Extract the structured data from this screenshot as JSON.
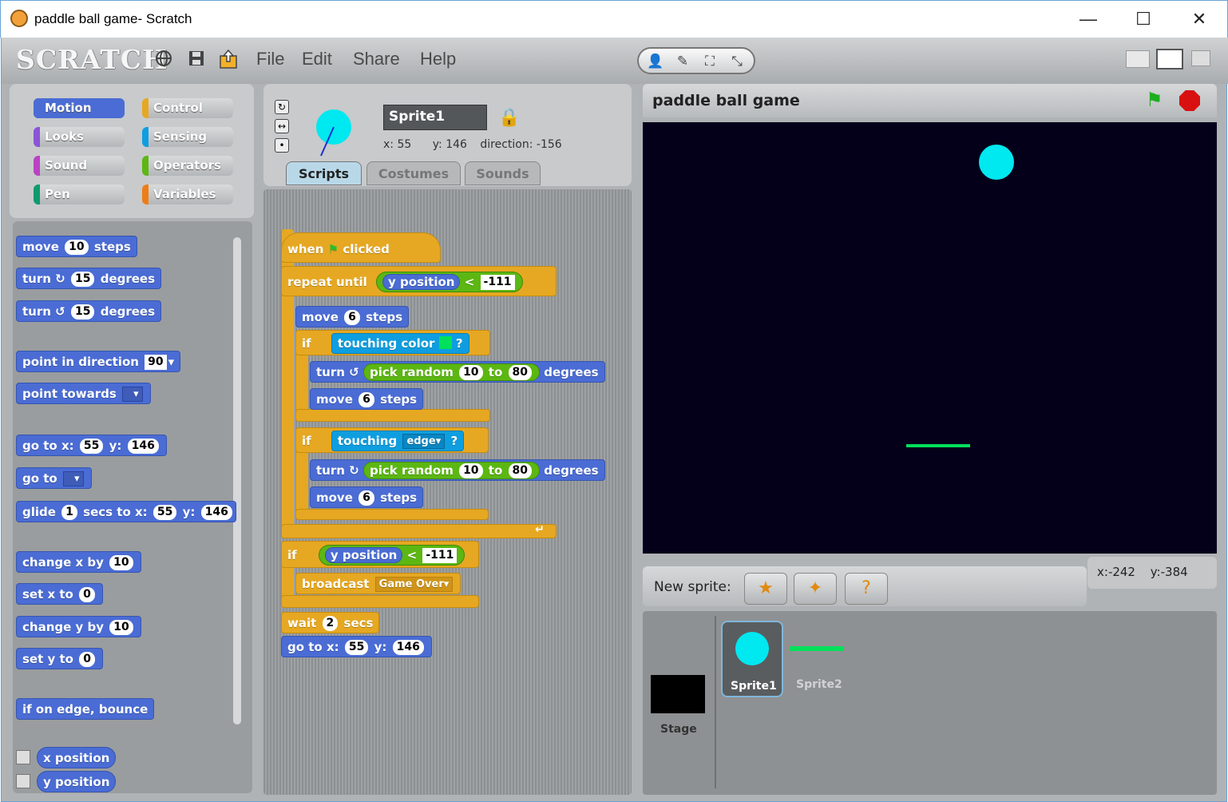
{
  "window": {
    "title": "paddle ball game- Scratch",
    "minimize": "—",
    "maximize": "☐",
    "close": "✕"
  },
  "menubar": {
    "logo": "SCRATCH",
    "items": [
      "File",
      "Edit",
      "Share",
      "Help"
    ],
    "icons": [
      "globe-icon",
      "save-icon",
      "share-icon"
    ],
    "tools": [
      "👤",
      "✎",
      "⛶",
      "⤡"
    ]
  },
  "categories": [
    {
      "label": "Motion",
      "color": "#4a6cd4"
    },
    {
      "label": "Control",
      "color": "#e6a822"
    },
    {
      "label": "Looks",
      "color": "#8a55d7"
    },
    {
      "label": "Sensing",
      "color": "#0e9ee0"
    },
    {
      "label": "Sound",
      "color": "#bb42c3"
    },
    {
      "label": "Operators",
      "color": "#5cb712"
    },
    {
      "label": "Pen",
      "color": "#0e9a6c"
    },
    {
      "label": "Variables",
      "color": "#ee7d16"
    }
  ],
  "palette": {
    "move": {
      "a": "move",
      "n": "10",
      "b": "steps"
    },
    "turn_cw": {
      "a": "turn",
      "n": "15",
      "b": "degrees"
    },
    "turn_ccw": {
      "a": "turn",
      "n": "15",
      "b": "degrees"
    },
    "point_dir": {
      "a": "point in direction",
      "n": "90"
    },
    "point_towards": {
      "a": "point towards"
    },
    "goto_xy": {
      "a": "go to x:",
      "x": "55",
      "b": "y:",
      "y": "146"
    },
    "goto": {
      "a": "go to"
    },
    "glide": {
      "a": "glide",
      "n": "1",
      "b": "secs to x:",
      "x": "55",
      "c": "y:",
      "y": "146"
    },
    "change_x": {
      "a": "change x by",
      "n": "10"
    },
    "set_x": {
      "a": "set x to",
      "n": "0"
    },
    "change_y": {
      "a": "change y by",
      "n": "10"
    },
    "set_y": {
      "a": "set y to",
      "n": "0"
    },
    "bounce": {
      "a": "if on edge, bounce"
    },
    "xpos": {
      "a": "x position"
    },
    "ypos": {
      "a": "y position"
    }
  },
  "sprite": {
    "name": "Sprite1",
    "x_label": "x:",
    "x": "55",
    "y_label": "y:",
    "y": "146",
    "dir_label": "direction:",
    "direction": "-156"
  },
  "tabs": [
    "Scripts",
    "Costumes",
    "Sounds"
  ],
  "script": {
    "hat": {
      "a": "when",
      "b": "clicked"
    },
    "repeat": {
      "a": "repeat until",
      "rep": "y position",
      "op": "<",
      "val": "-111"
    },
    "move1": {
      "a": "move",
      "n": "6",
      "b": "steps"
    },
    "if1": {
      "a": "if",
      "c": "touching color",
      "q": "?"
    },
    "turn1": {
      "a": "turn",
      "r": "pick random",
      "n1": "10",
      "to": "to",
      "n2": "80",
      "b": "degrees"
    },
    "move2": {
      "a": "move",
      "n": "6",
      "b": "steps"
    },
    "if2": {
      "a": "if",
      "c": "touching",
      "opt": "edge",
      "q": "?"
    },
    "turn2": {
      "a": "turn",
      "r": "pick random",
      "n1": "10",
      "to": "to",
      "n2": "80",
      "b": "degrees"
    },
    "move3": {
      "a": "move",
      "n": "6",
      "b": "steps"
    },
    "if3": {
      "a": "if",
      "rep": "y position",
      "op": "<",
      "val": "-111"
    },
    "broadcast": {
      "a": "broadcast",
      "opt": "Game Over"
    },
    "wait": {
      "a": "wait",
      "n": "2",
      "b": "secs"
    },
    "goto": {
      "a": "go to x:",
      "x": "55",
      "b": "y:",
      "y": "146"
    }
  },
  "stage": {
    "title": "paddle ball game",
    "mouse_x_label": "x:",
    "mouse_x": "-242",
    "mouse_y_label": "y:",
    "mouse_y": "-384"
  },
  "spritelist": {
    "new_sprite": "New sprite:",
    "stage_label": "Stage",
    "items": [
      "Sprite1",
      "Sprite2"
    ]
  },
  "colors": {
    "motion": "#4a6cd4",
    "control": "#e6a822",
    "operators": "#5cb712",
    "sensing": "#0e9ee0",
    "ball": "#00e8f0",
    "paddle": "#00e05a"
  }
}
